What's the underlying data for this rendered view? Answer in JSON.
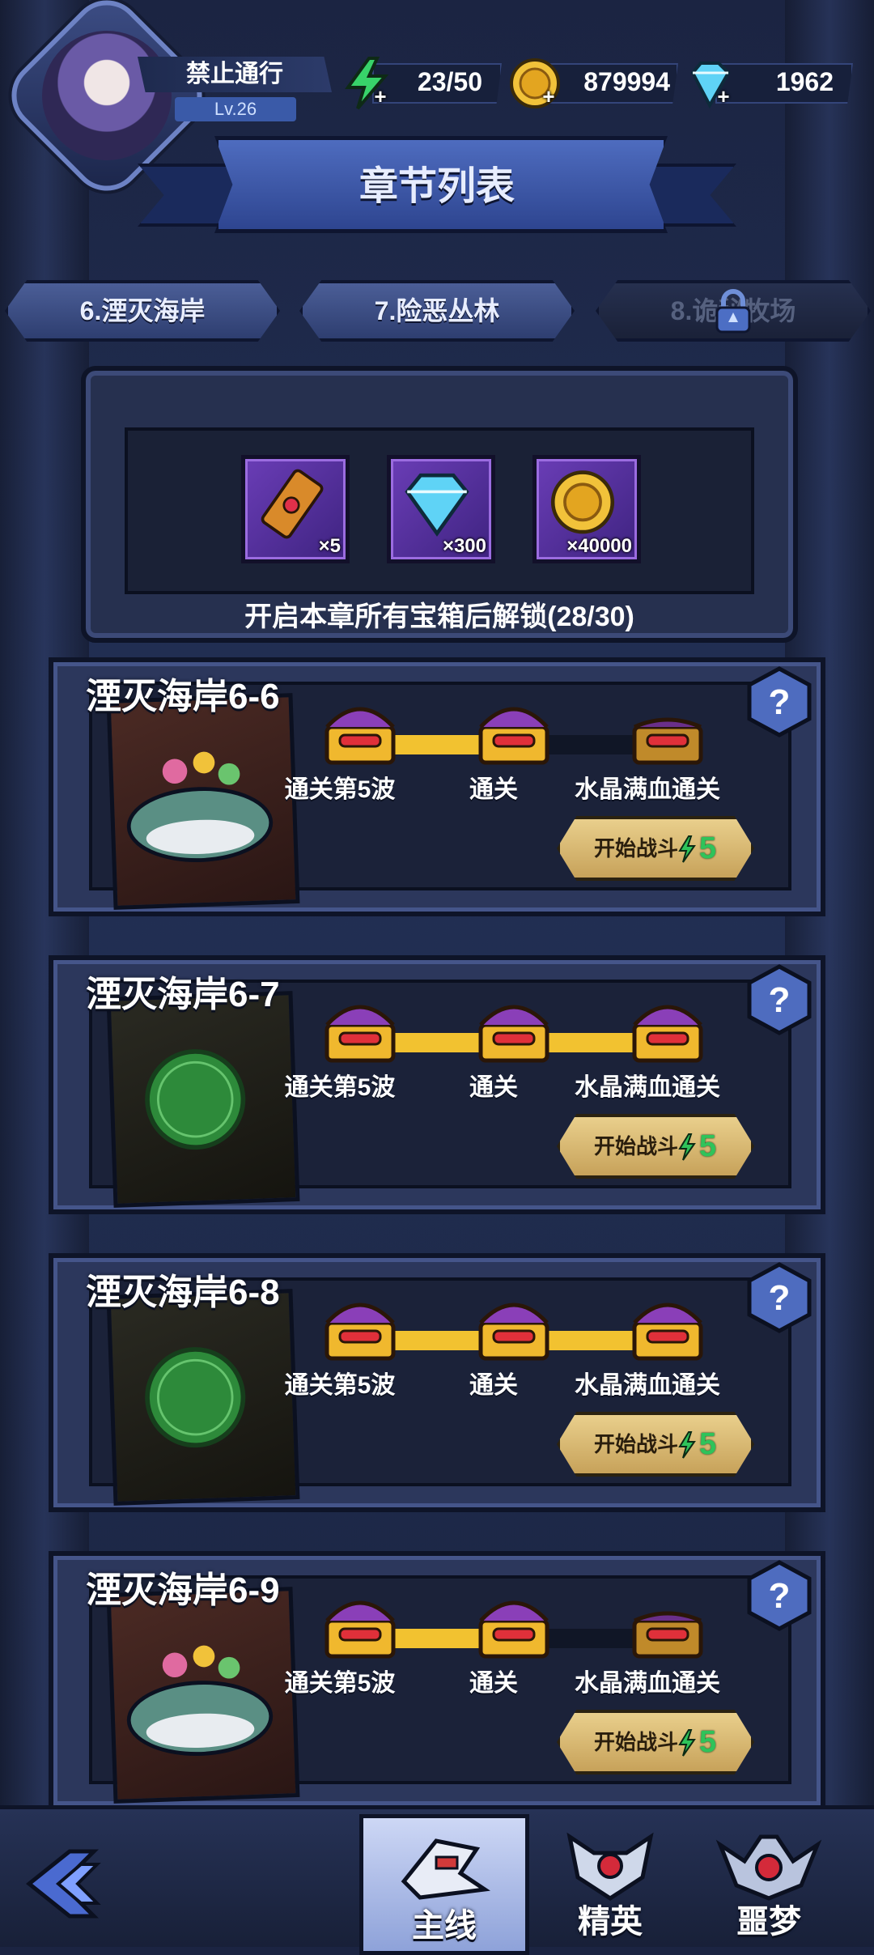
{
  "player": {
    "name": "禁止通行",
    "level": "Lv.26"
  },
  "resources": {
    "energy": "23/50",
    "gold": "879994",
    "diamonds": "1962"
  },
  "header": {
    "title": "章节列表"
  },
  "chapter_tabs": [
    {
      "label": "6.湮灭海岸",
      "locked": false
    },
    {
      "label": "7.险恶丛林",
      "locked": false
    },
    {
      "label": "8.诡秘牧场",
      "locked": true
    }
  ],
  "chapter_reward": {
    "items": [
      {
        "icon": "scroll-icon",
        "count": "×5"
      },
      {
        "icon": "diamond-icon",
        "count": "×300"
      },
      {
        "icon": "gold-coin-icon",
        "count": "×40000"
      }
    ],
    "unlock_note": "开启本章所有宝箱后解锁(28/30)"
  },
  "stages": [
    {
      "title": "湮灭海岸6-6",
      "thumb": "whale-monster",
      "perfect": false,
      "chests": [
        {
          "label": "通关第5波",
          "opened": true
        },
        {
          "label": "通关",
          "opened": true
        },
        {
          "label": "水晶满血通关",
          "opened": false
        }
      ],
      "start_label": "开始战斗",
      "energy_cost": "5"
    },
    {
      "title": "湮灭海岸6-7",
      "thumb": "mushroom-monster",
      "perfect": true,
      "chests": [
        {
          "label": "通关第5波",
          "opened": true
        },
        {
          "label": "通关",
          "opened": true
        },
        {
          "label": "水晶满血通关",
          "opened": true
        }
      ],
      "start_label": "开始战斗",
      "energy_cost": "5"
    },
    {
      "title": "湮灭海岸6-8",
      "thumb": "crab-monster",
      "perfect": true,
      "chests": [
        {
          "label": "通关第5波",
          "opened": true
        },
        {
          "label": "通关",
          "opened": true
        },
        {
          "label": "水晶满血通关",
          "opened": true
        }
      ],
      "start_label": "开始战斗",
      "energy_cost": "5"
    },
    {
      "title": "湮灭海岸6-9",
      "thumb": "whale-monster",
      "perfect": false,
      "chests": [
        {
          "label": "通关第5波",
          "opened": true
        },
        {
          "label": "通关",
          "opened": true
        },
        {
          "label": "水晶满血通关",
          "opened": false
        }
      ],
      "start_label": "开始战斗",
      "energy_cost": "5"
    }
  ],
  "bottom_nav": [
    {
      "label": "主线",
      "icon": "mainline-icon",
      "active": true
    },
    {
      "label": "精英",
      "icon": "elite-skull-icon",
      "active": false
    },
    {
      "label": "噩梦",
      "icon": "nightmare-demon-icon",
      "active": false
    }
  ],
  "colors": {
    "accent": "#4e6cbf",
    "energy": "#2fc35a",
    "gold": "#f1c23a",
    "diamond": "#5fd3f6",
    "track_done": "#f2c230"
  }
}
